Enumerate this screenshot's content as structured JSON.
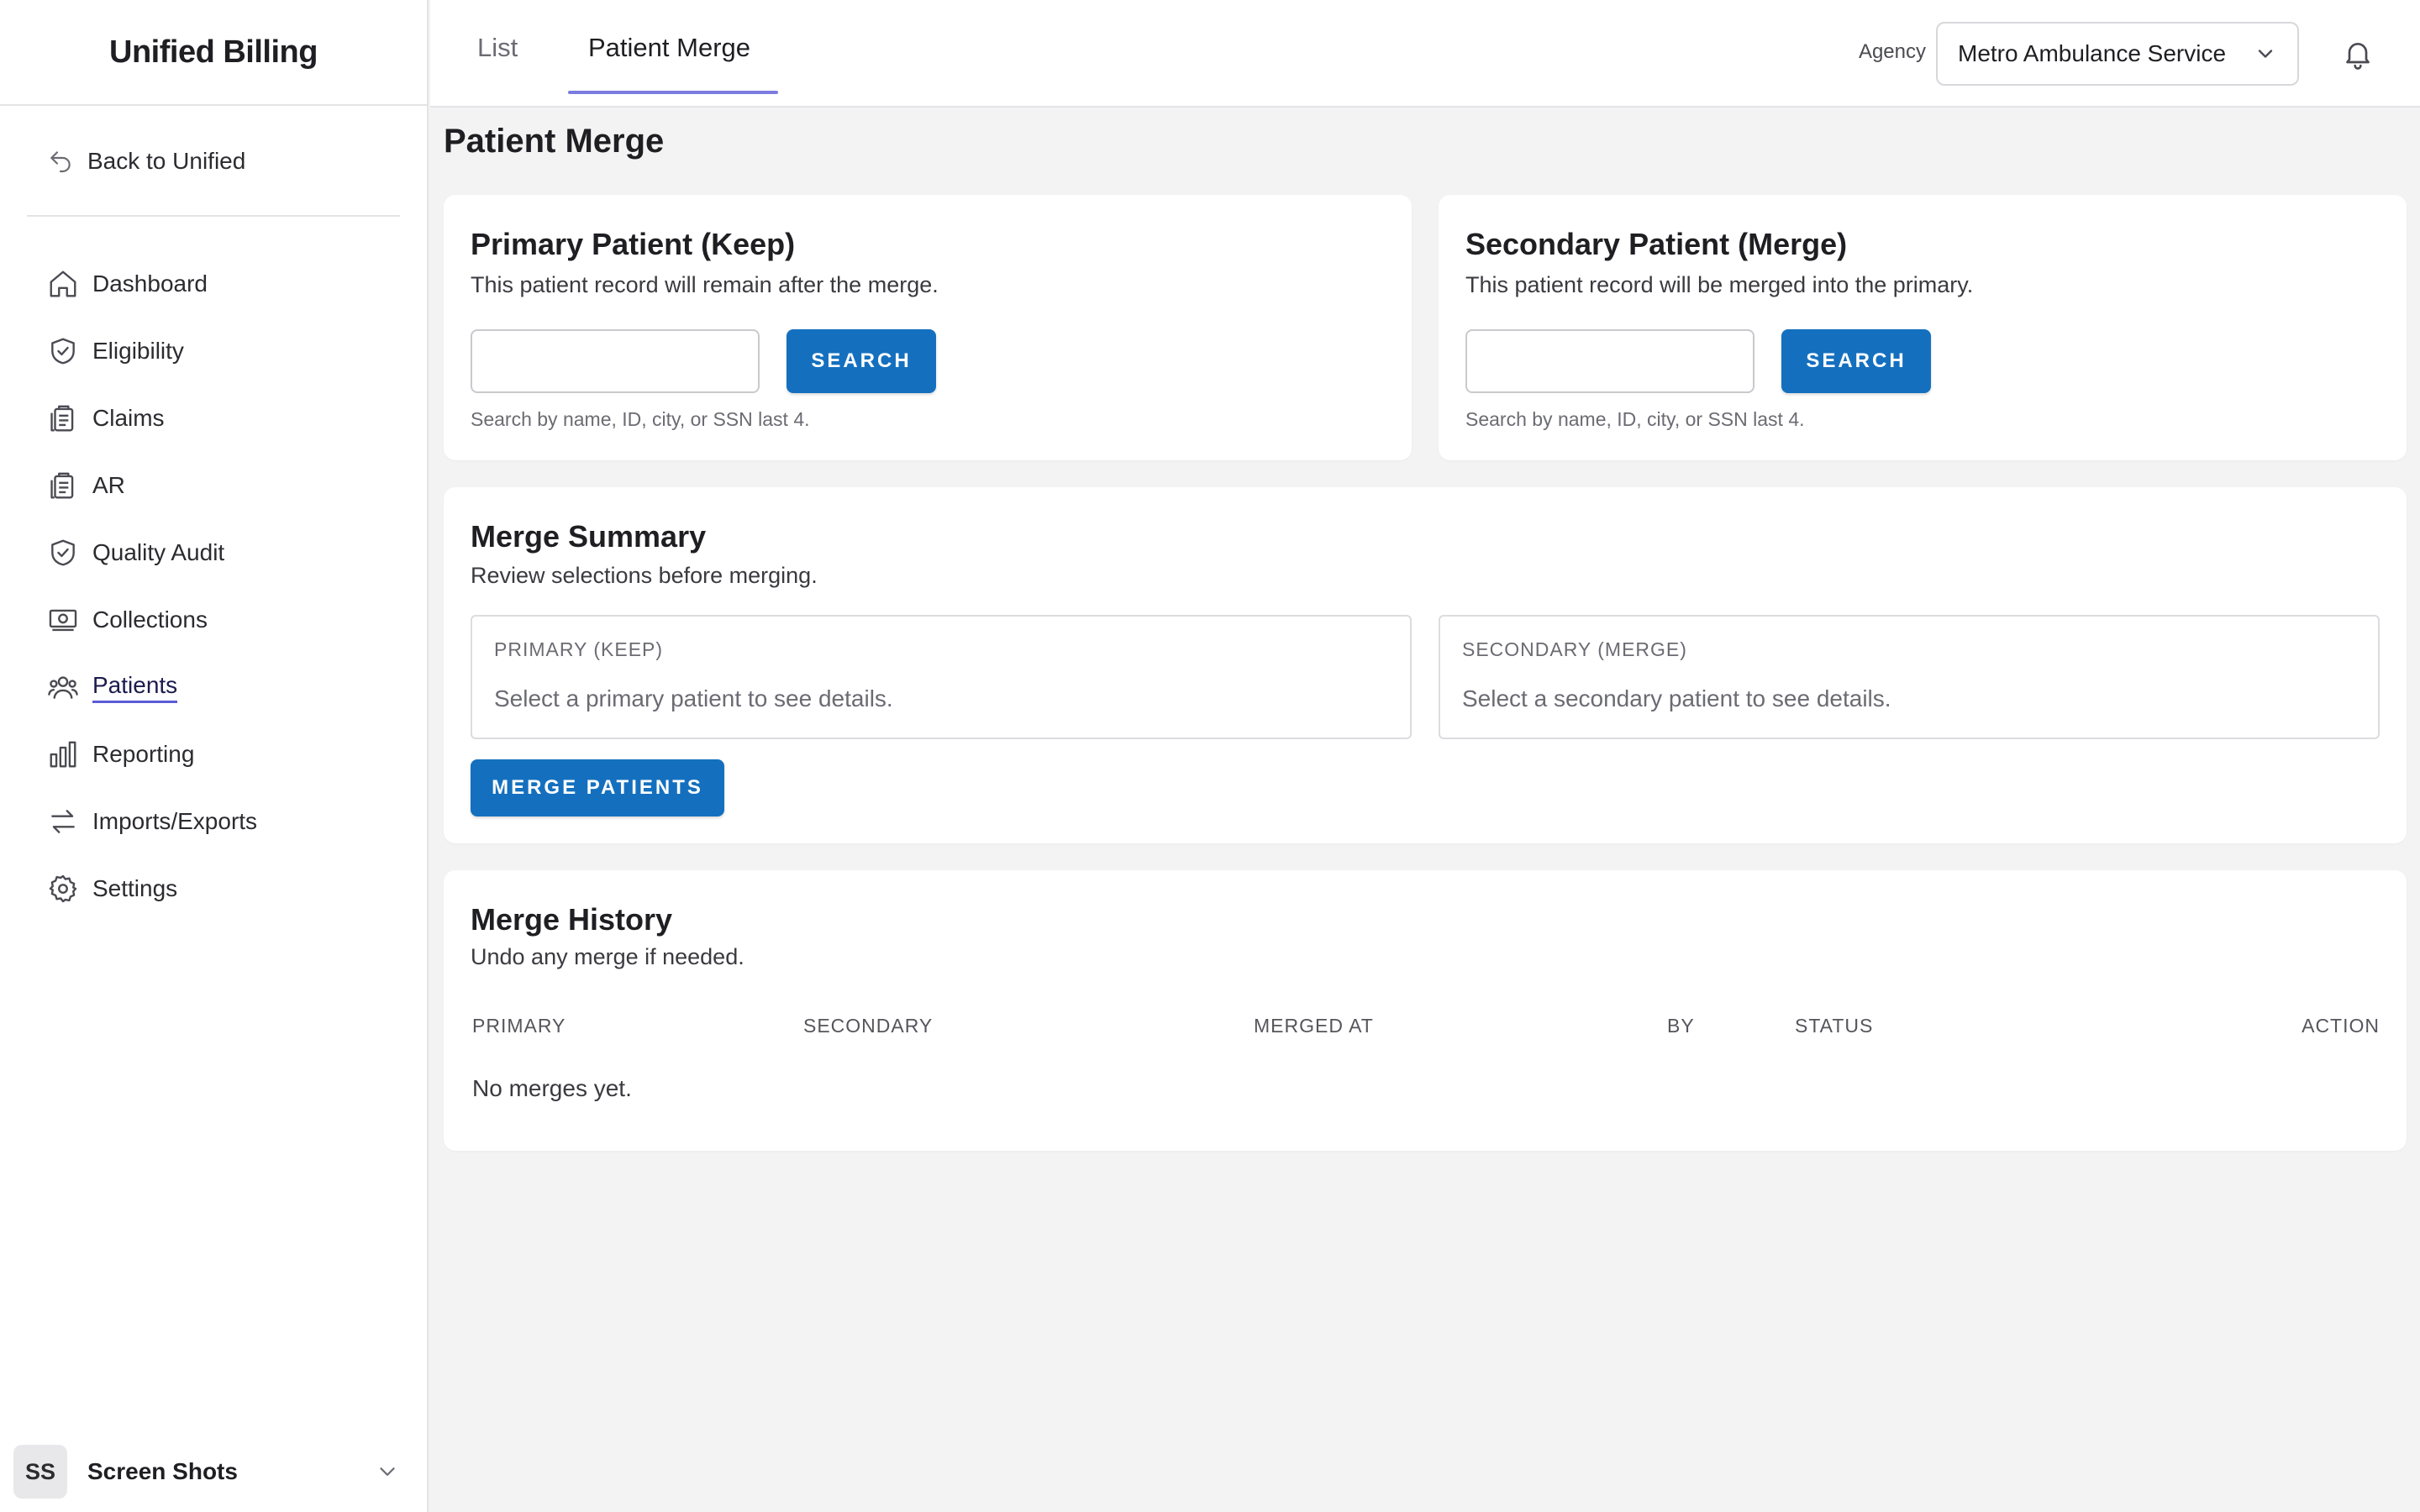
{
  "brand": "Unified Billing",
  "sidebar": {
    "back_label": "Back to Unified",
    "items": [
      {
        "label": "Dashboard",
        "icon": "home-icon"
      },
      {
        "label": "Eligibility",
        "icon": "shield-check-icon"
      },
      {
        "label": "Claims",
        "icon": "clipboard-icon"
      },
      {
        "label": "AR",
        "icon": "clipboard-icon"
      },
      {
        "label": "Quality Audit",
        "icon": "shield-check-icon"
      },
      {
        "label": "Collections",
        "icon": "cash-icon"
      },
      {
        "label": "Patients",
        "icon": "users-icon",
        "active": true
      },
      {
        "label": "Reporting",
        "icon": "bar-chart-icon"
      },
      {
        "label": "Imports/Exports",
        "icon": "arrows-icon"
      },
      {
        "label": "Settings",
        "icon": "gear-icon"
      }
    ],
    "user": {
      "initials": "SS",
      "name": "Screen Shots"
    }
  },
  "topbar": {
    "tabs": [
      {
        "label": "List"
      },
      {
        "label": "Patient Merge",
        "active": true
      }
    ],
    "agency_label": "Agency",
    "agency_value": "Metro Ambulance Service"
  },
  "page": {
    "title": "Patient Merge",
    "primary": {
      "title": "Primary Patient (Keep)",
      "subtitle": "This patient record will remain after the merge.",
      "search_value": "",
      "search_button": "SEARCH",
      "helper": "Search by name, ID, city, or SSN last 4."
    },
    "secondary": {
      "title": "Secondary Patient (Merge)",
      "subtitle": "This patient record will be merged into the primary.",
      "search_value": "",
      "search_button": "SEARCH",
      "helper": "Search by name, ID, city, or SSN last 4."
    },
    "summary": {
      "title": "Merge Summary",
      "subtitle": "Review selections before merging.",
      "primary_caption": "PRIMARY (KEEP)",
      "primary_message": "Select a primary patient to see details.",
      "secondary_caption": "SECONDARY (MERGE)",
      "secondary_message": "Select a secondary patient to see details.",
      "merge_button": "MERGE PATIENTS"
    },
    "history": {
      "title": "Merge History",
      "subtitle": "Undo any merge if needed.",
      "columns": [
        "PRIMARY",
        "SECONDARY",
        "MERGED AT",
        "BY",
        "STATUS",
        "ACTION"
      ],
      "empty_message": "No merges yet."
    }
  },
  "colors": {
    "accent": "#1470bf",
    "tab_underline": "#7b7be0",
    "active_nav_underline": "#5b5bd6"
  }
}
